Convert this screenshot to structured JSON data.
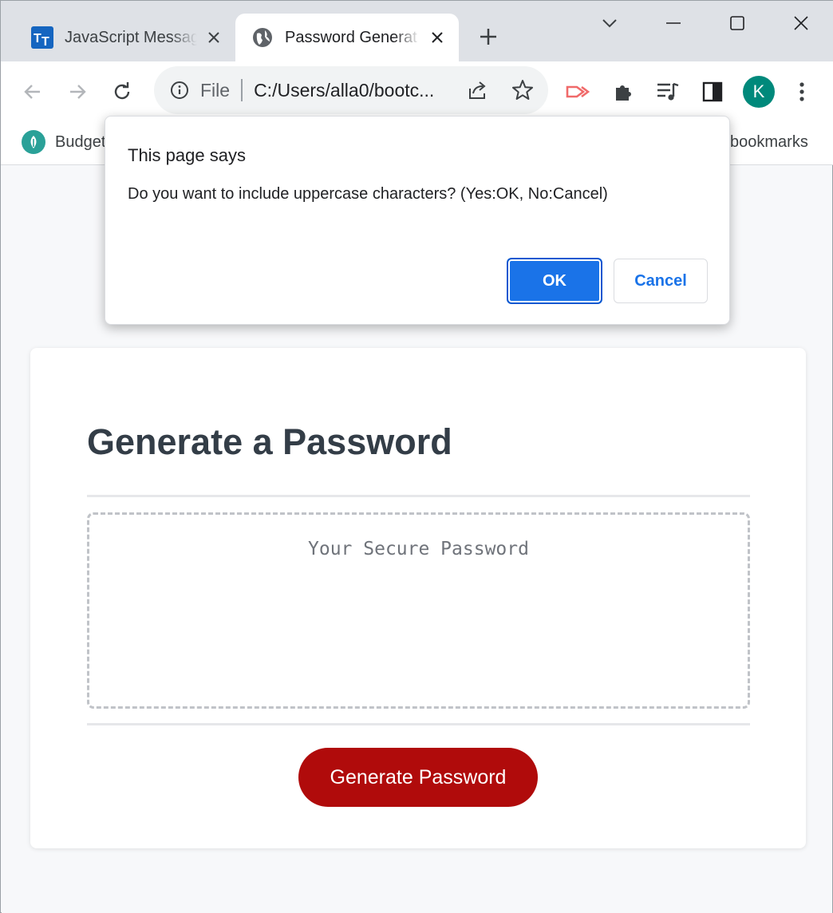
{
  "browser": {
    "tabs": [
      {
        "title": "JavaScript Messag",
        "favicon": "tt-logo-icon",
        "active": false
      },
      {
        "title": "Password Generat",
        "favicon": "globe-icon",
        "active": true
      }
    ],
    "omnibox": {
      "scheme_label": "File",
      "url": "C:/Users/alla0/bootc..."
    },
    "profile_initial": "K",
    "bookmarks": {
      "first_item": "Budget",
      "other": "bookmarks"
    }
  },
  "dialog": {
    "title": "This page says",
    "message": "Do you want to include uppercase characters? (Yes:OK, No:Cancel)",
    "ok_label": "OK",
    "cancel_label": "Cancel"
  },
  "page": {
    "heading": "Generate a Password",
    "password_placeholder": "Your Secure Password",
    "generate_button": "Generate Password"
  },
  "colors": {
    "accent": "#1a73e8",
    "generate_button": "#b00b0b",
    "heading": "#333d47",
    "avatar": "#00897b"
  }
}
